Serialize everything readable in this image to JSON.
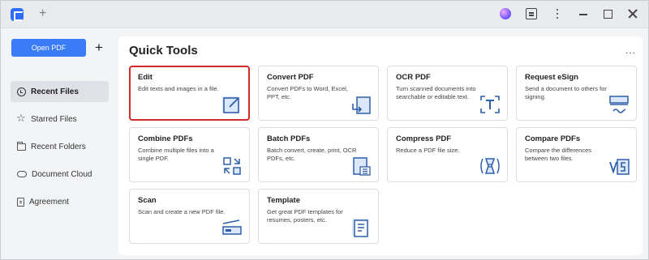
{
  "titlebar": {
    "new_tab_symbol": "+"
  },
  "sidebar": {
    "open_pdf_label": "Open PDF",
    "add_symbol": "+",
    "items": [
      {
        "label": "Recent Files",
        "icon": "clock-icon",
        "active": true
      },
      {
        "label": "Starred Files",
        "icon": "star-icon",
        "active": false
      },
      {
        "label": "Recent Folders",
        "icon": "folder-icon",
        "active": false
      },
      {
        "label": "Document Cloud",
        "icon": "cloud-icon",
        "active": false
      },
      {
        "label": "Agreement",
        "icon": "document-icon",
        "active": false
      }
    ]
  },
  "main": {
    "title": "Quick Tools",
    "more_symbol": "...",
    "tools": [
      {
        "title": "Edit",
        "desc": "Edit texts and images in a file.",
        "icon": "edit-icon",
        "selected": true
      },
      {
        "title": "Convert PDF",
        "desc": "Convert PDFs to Word, Excel, PPT, etc.",
        "icon": "convert-icon"
      },
      {
        "title": "OCR PDF",
        "desc": "Turn scanned documents into searchable or editable text.",
        "icon": "ocr-icon"
      },
      {
        "title": "Request eSign",
        "desc": "Send a document to others for signing.",
        "icon": "esign-icon"
      },
      {
        "title": "Combine PDFs",
        "desc": "Combine multiple files into a single PDF.",
        "icon": "combine-icon"
      },
      {
        "title": "Batch PDFs",
        "desc": "Batch convert, create, print, OCR PDFs, etc.",
        "icon": "batch-icon"
      },
      {
        "title": "Compress PDF",
        "desc": "Reduce a PDF file size.",
        "icon": "compress-icon"
      },
      {
        "title": "Compare PDFs",
        "desc": "Compare the differences between two files.",
        "icon": "compare-icon"
      },
      {
        "title": "Scan",
        "desc": "Scan and create a new PDF file.",
        "icon": "scan-icon"
      },
      {
        "title": "Template",
        "desc": "Get great PDF templates for resumes, posters, etc.",
        "icon": "template-icon"
      }
    ]
  },
  "colors": {
    "accent": "#3a7bf7",
    "selection_border": "#d42a2a"
  }
}
